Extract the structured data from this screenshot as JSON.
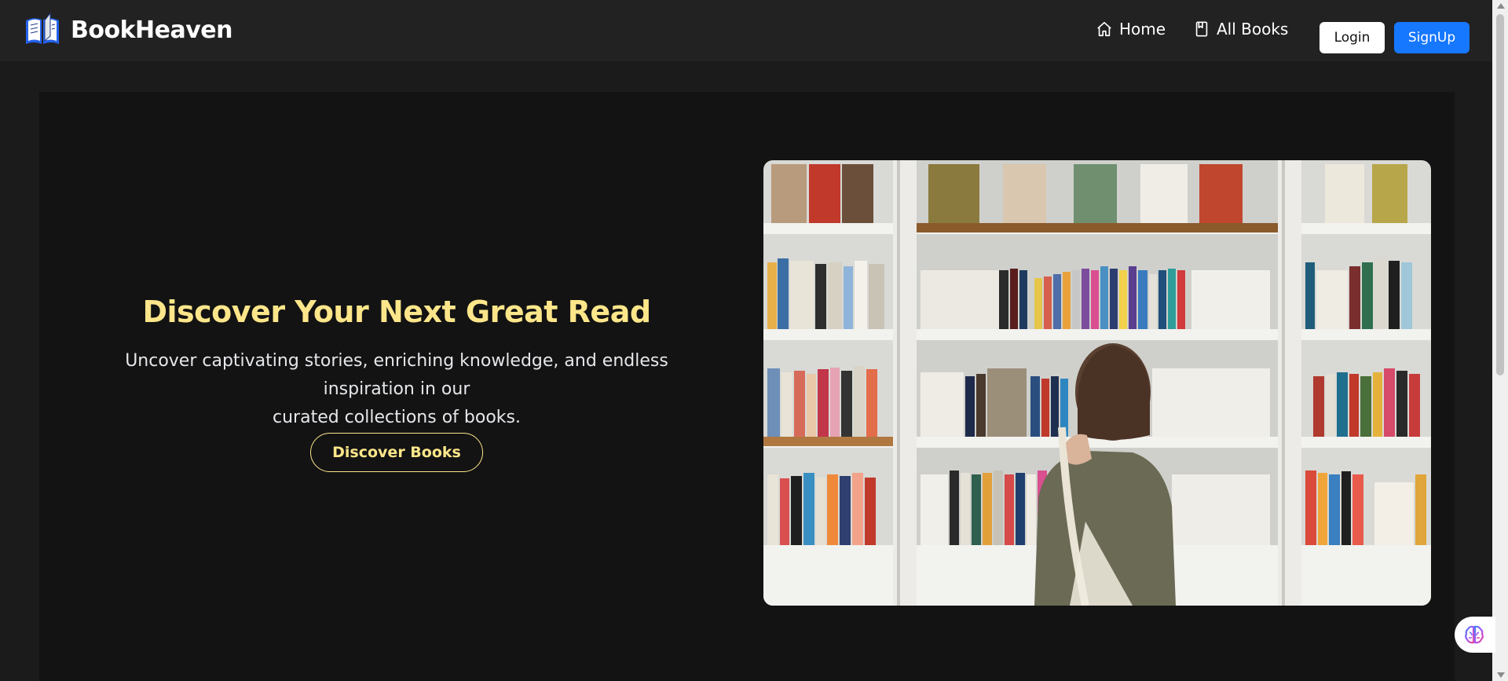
{
  "brand": {
    "name": "BookHeaven",
    "logo_icon": "open-book-icon"
  },
  "nav": {
    "links": [
      {
        "label": "Home",
        "icon": "home-icon"
      },
      {
        "label": "All Books",
        "icon": "book-icon"
      }
    ],
    "login_label": "Login",
    "signup_label": "SignUp"
  },
  "hero": {
    "title": "Discover Your Next Great Read",
    "subtitle_line1": "Uncover captivating stories, enriching knowledge, and endless inspiration in our",
    "subtitle_line2": "curated collections of books.",
    "button_label": "Discover Books"
  },
  "colors": {
    "accent": "#fde68a",
    "primary": "#1677ff",
    "nav_bg": "#222222",
    "hero_bg": "#131313",
    "page_bg": "#1b1b1b"
  },
  "widget": {
    "icon": "brain-icon"
  }
}
